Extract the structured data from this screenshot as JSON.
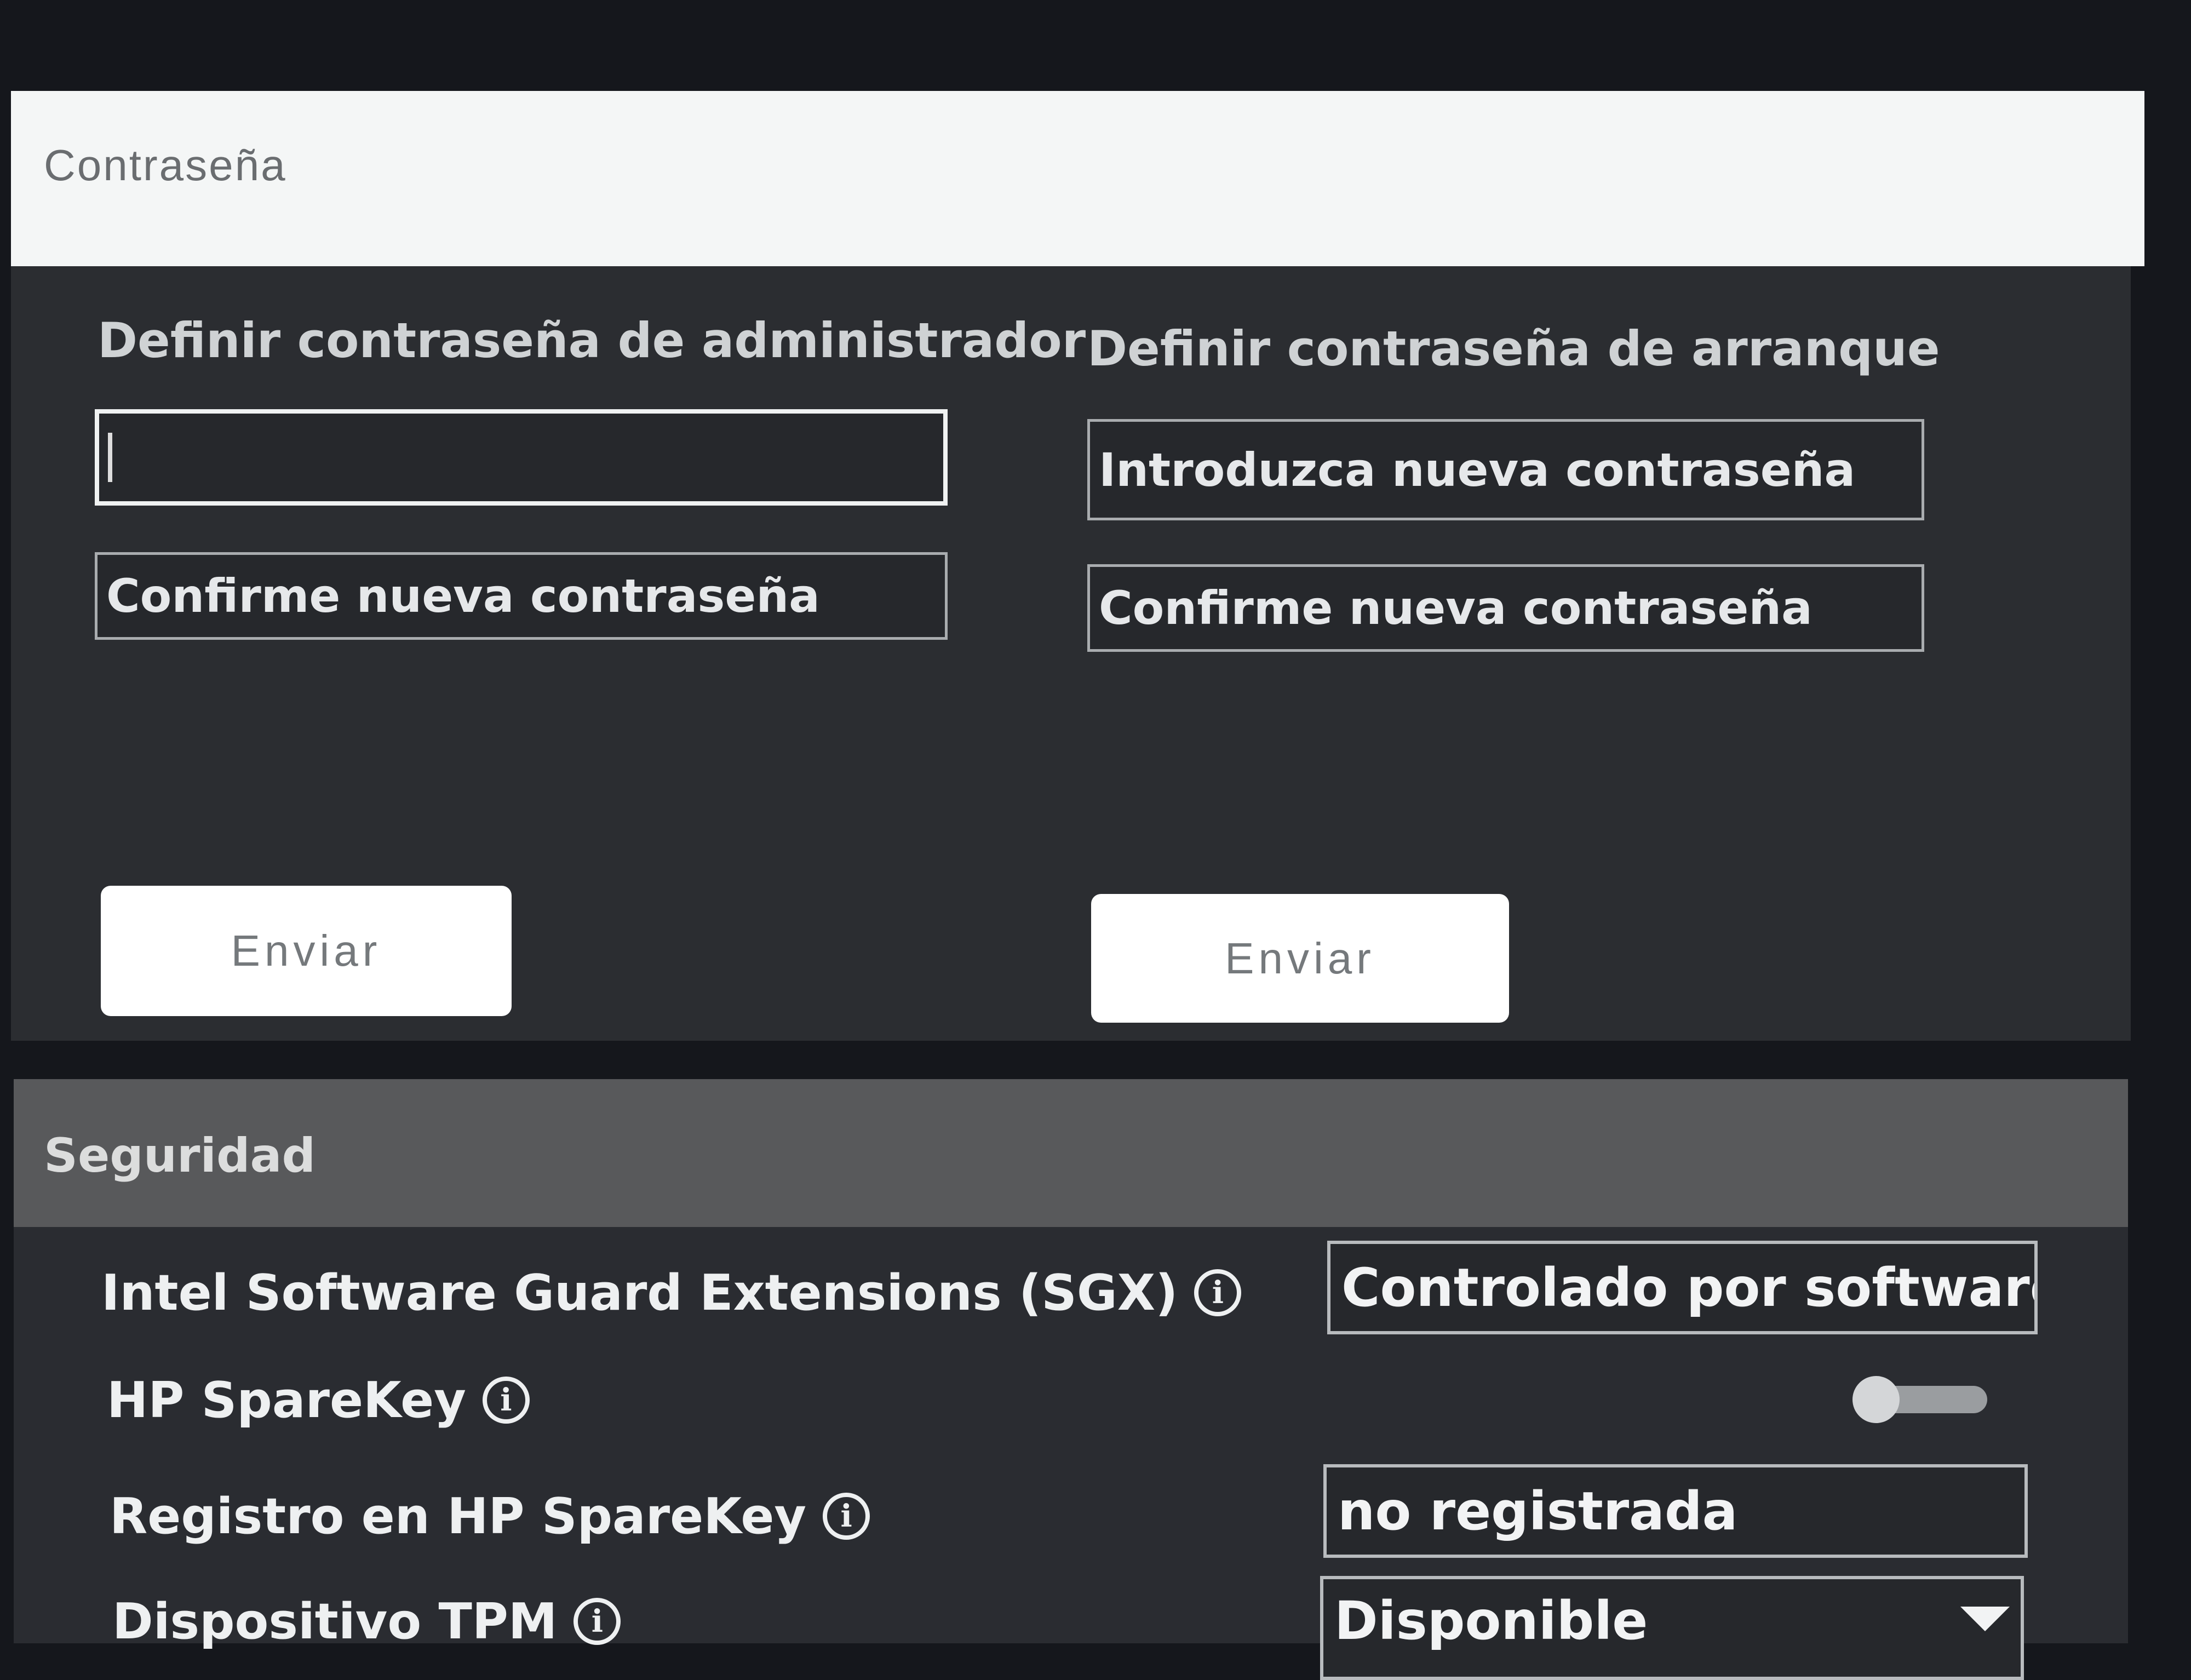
{
  "password_section": {
    "title": "Contraseña",
    "admin": {
      "label": "Definir contraseña de administrador",
      "new_value": "",
      "confirm_placeholder": "Confirme nueva contraseña",
      "submit": "Enviar"
    },
    "boot": {
      "label": "Definir contraseña de arranque",
      "new_placeholder": "Introduzca nueva contraseña",
      "confirm_placeholder": "Confirme nueva contraseña",
      "submit": "Enviar"
    }
  },
  "security_section": {
    "title": "Seguridad",
    "sgx": {
      "label": "Intel Software Guard Extensions (SGX)",
      "value": "Controlado por software"
    },
    "sparekey": {
      "label": "HP SpareKey",
      "enabled": false
    },
    "sparekey_registration": {
      "label": "Registro en HP SpareKey",
      "value": "no registrada"
    },
    "tpm": {
      "label": "Dispositivo TPM",
      "value": "Disponible"
    },
    "info_glyph": "ⓘ"
  }
}
